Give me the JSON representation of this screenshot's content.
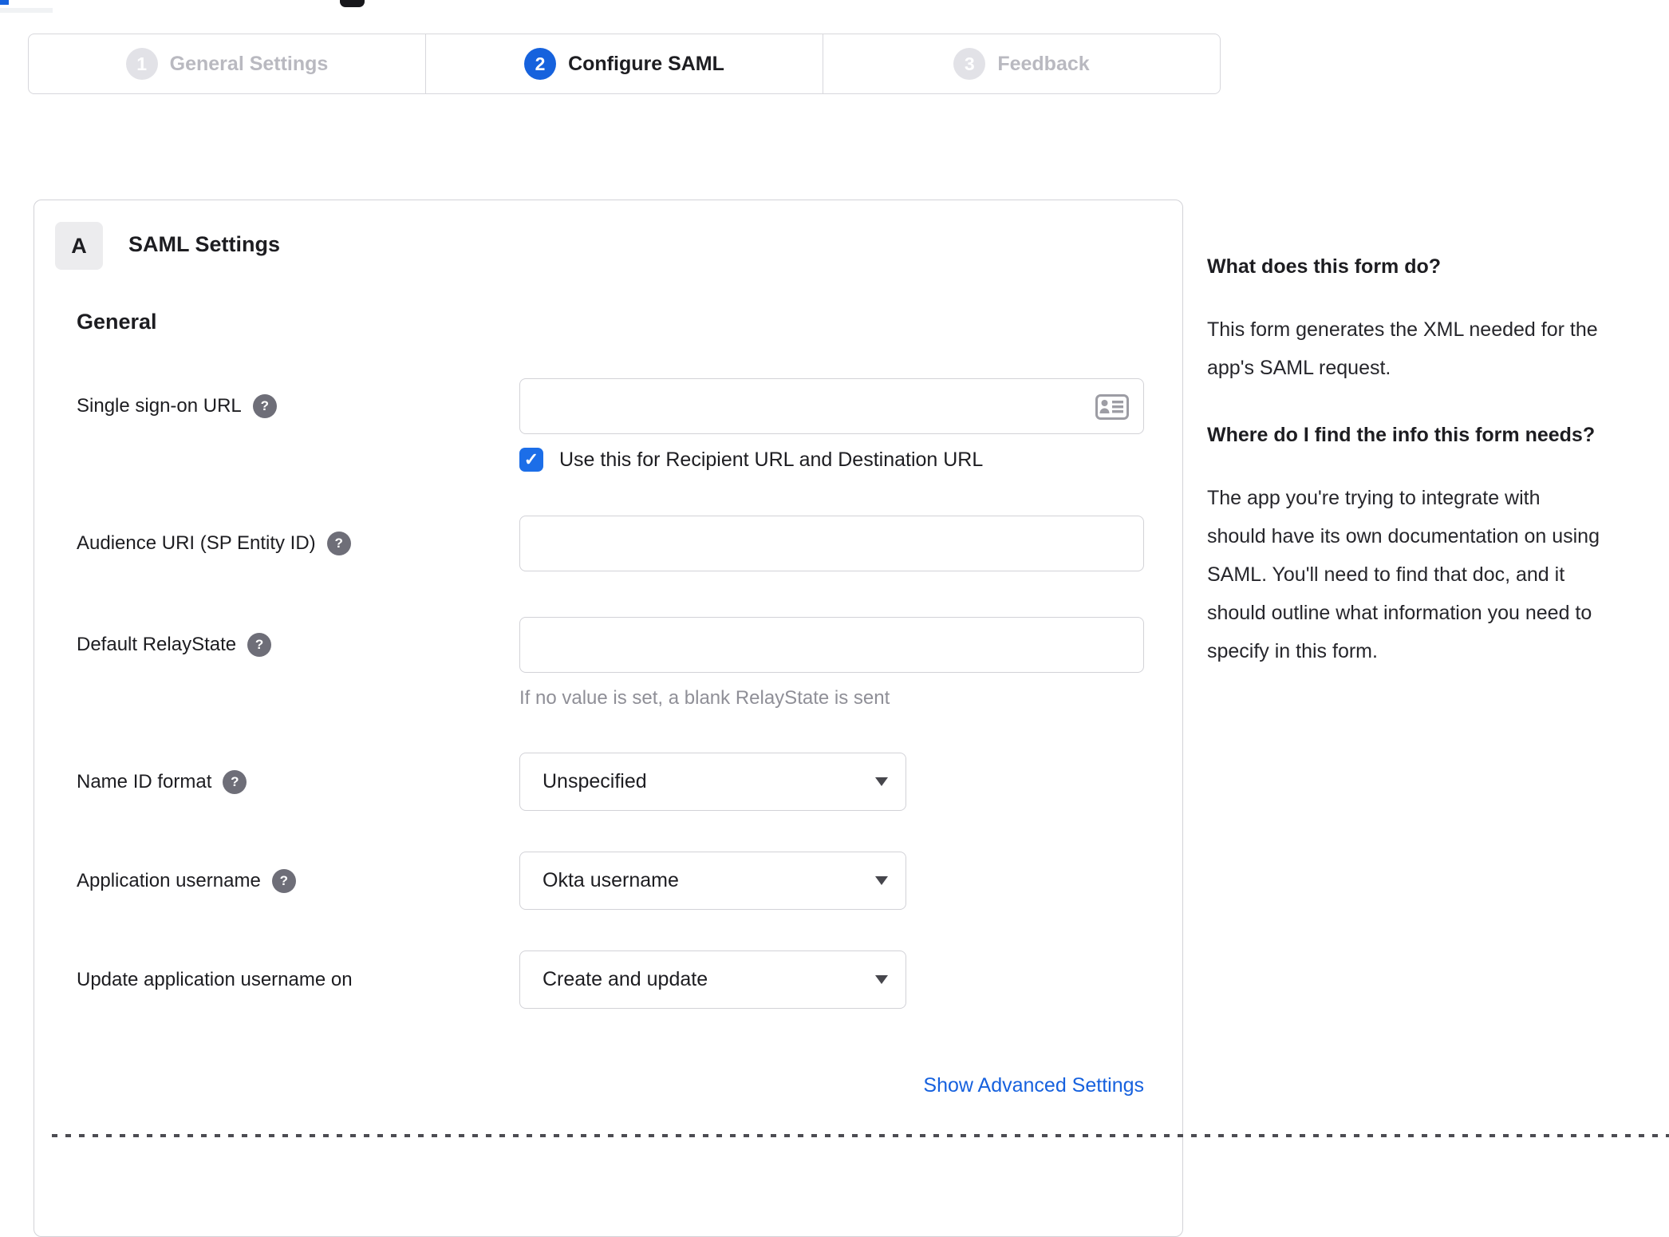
{
  "colors": {
    "accent_blue": "#1662dd",
    "checkbox_blue": "#1c6ee8",
    "link_blue": "#1661de",
    "inactive_gray": "#e2e2e7",
    "border_gray": "#d2d2d7",
    "text_dark": "#1d1d21",
    "hint_gray": "#8f8f97"
  },
  "stepper": {
    "steps": [
      {
        "number": "1",
        "label": "General Settings",
        "state": "inactive"
      },
      {
        "number": "2",
        "label": "Configure SAML",
        "state": "active"
      },
      {
        "number": "3",
        "label": "Feedback",
        "state": "inactive"
      }
    ]
  },
  "panel": {
    "badge": "A",
    "title": "SAML Settings",
    "section_title": "General",
    "fields": [
      {
        "label": "Single sign-on URL",
        "control": "text",
        "value": ""
      },
      {
        "label": "Audience URI (SP Entity ID)",
        "control": "text",
        "value": ""
      },
      {
        "label": "Default RelayState",
        "control": "text",
        "value": "",
        "hint": "If no value is set, a blank RelayState is sent"
      },
      {
        "label": "Name ID format",
        "control": "select",
        "value": "Unspecified"
      },
      {
        "label": "Application username",
        "control": "select",
        "value": "Okta username"
      },
      {
        "label": "Update application username on",
        "control": "select",
        "value": "Create and update"
      }
    ],
    "checkbox": {
      "label": "Use this for Recipient URL and Destination URL",
      "checked": true,
      "checkmark": "✓"
    },
    "advanced_link": "Show Advanced Settings"
  },
  "sidebar": {
    "heading1": "What does this form do?",
    "paragraph1": "This form generates the XML needed for the app's SAML request.",
    "heading2": "Where do I find the info this form needs?",
    "paragraph2": "The app you're trying to integrate with should have its own documentation on using SAML. You'll need to find that doc, and it should outline what information you need to specify in this form."
  }
}
